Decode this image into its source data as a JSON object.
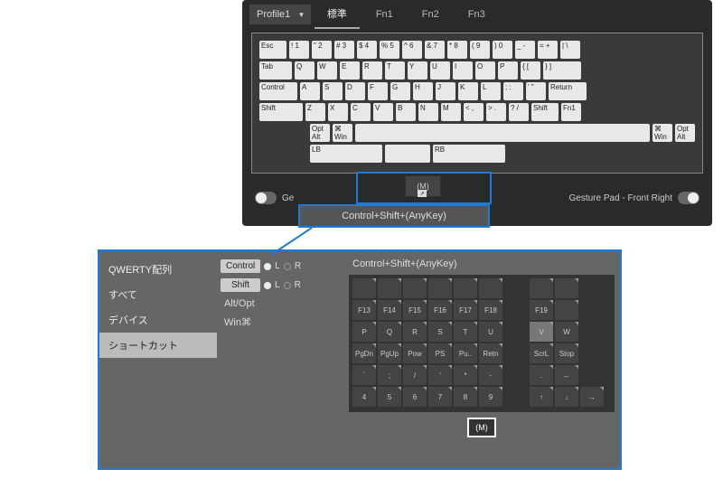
{
  "top": {
    "profile": "Profile1",
    "tabs": [
      "標準",
      "Fn1",
      "Fn2",
      "Fn3"
    ],
    "active_tab": 0,
    "gesture_left": "Ge",
    "gesture_right": "Gesture Pad - Front Right",
    "rows": {
      "r1": [
        "Esc",
        "!\n1",
        "\"\n2",
        "#\n3",
        "$\n4",
        "%\n5",
        "^\n6",
        "&\n7",
        "*\n8",
        "(\n9",
        ")\n0",
        "_\n-",
        "=\n+",
        "|\n\\"
      ],
      "r2": [
        "Tab",
        "Q",
        "W",
        "E",
        "R",
        "T",
        "Y",
        "U",
        "I",
        "O",
        "P",
        "{\n[",
        "}\n]"
      ],
      "r3": [
        "Control",
        "A",
        "S",
        "D",
        "F",
        "G",
        "H",
        "J",
        "K",
        "L",
        ";\n:",
        "'\n\"",
        "Return"
      ],
      "r4": [
        "Shift",
        "Z",
        "X",
        "C",
        "V",
        "B",
        "N",
        "M",
        "<\n,",
        ">\n.",
        "?\n/",
        "Shift",
        "Fn1"
      ],
      "r5": [
        "Opt\nAlt",
        "⌘\nWin",
        "",
        "⌘\nWin",
        "Opt\nAlt"
      ]
    },
    "below": [
      "LB",
      "",
      "RB"
    ]
  },
  "callout": {
    "m": "(M)",
    "tooltip": "Control+Shift+(AnyKey)"
  },
  "bottom": {
    "side": [
      "QWERTY配列",
      "すべて",
      "デバイス",
      "ショートカット"
    ],
    "side_active": 3,
    "mods": {
      "control": "Control",
      "shift": "Shift",
      "alt": "Alt/Opt",
      "win": "Win⌘",
      "L": "L",
      "R": "R"
    },
    "title": "Control+Shift+(AnyKey)",
    "grid": [
      [
        "",
        "",
        "",
        "",
        "",
        "",
        "",
        "",
        " ",
        "",
        "",
        ""
      ],
      [
        "F13",
        "F14",
        "F15",
        "F16",
        "F17",
        "F18",
        " ",
        "F19",
        "",
        "",
        ""
      ],
      [
        "P",
        "Q",
        "R",
        "S",
        "T",
        "U",
        " ",
        "V",
        "W",
        "",
        ""
      ],
      [
        "PgDn",
        "PgUp",
        "Pow",
        "PS",
        "Pu..",
        "Retn",
        " ",
        "ScrL",
        "Stop",
        "",
        ""
      ],
      [
        "`",
        ";",
        "/",
        "'",
        "*",
        "-",
        " ",
        ".",
        "←",
        "",
        ""
      ],
      [
        "4",
        "5",
        "6",
        "7",
        "8",
        "9",
        " ",
        "↑",
        "↓",
        "→",
        ""
      ]
    ],
    "m_btn": "(M)"
  }
}
